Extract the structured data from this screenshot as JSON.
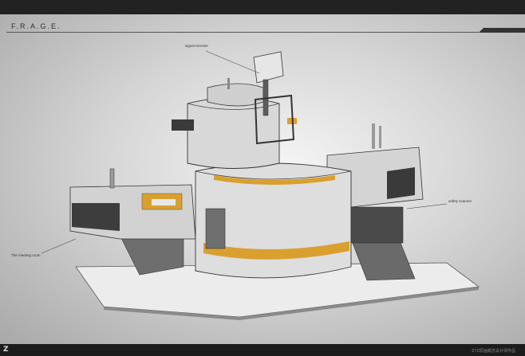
{
  "header": {
    "title": "F.R.A.G.E."
  },
  "annotations": {
    "signal_receiver": "signal receiver",
    "safety_scanner": "safety scanner",
    "meeting_room": "The meeting room"
  },
  "footer": {
    "logo": "Z",
    "credit": "ZYZ原画概念设计师作品"
  },
  "colors": {
    "accent": "#d9a030",
    "hull": "#d8d8d8",
    "dark_window": "#3a3a3a",
    "background_edge": "#a8a8a8"
  },
  "icons": [
    "studio-logo-icon"
  ]
}
